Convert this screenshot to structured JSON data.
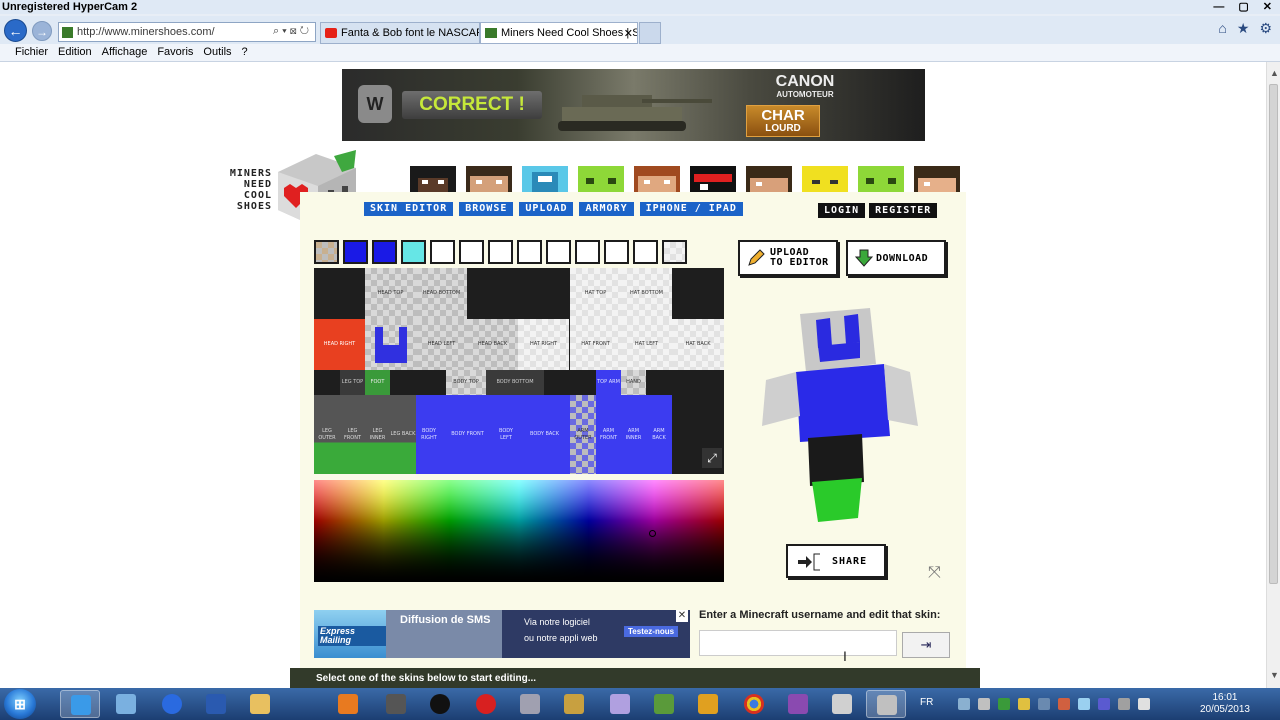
{
  "window": {
    "title": "Unregistered HyperCam 2",
    "controls": [
      "—",
      "▢",
      "✕"
    ]
  },
  "browser": {
    "url": "http://www.minershoes.com/",
    "tabs": [
      {
        "label": "Fanta & Bob font le NASCAR E...",
        "active": false
      },
      {
        "label": "Miners Need Cool Shoes | S...",
        "active": true
      }
    ],
    "tab_close": "✕",
    "menu": [
      "Fichier",
      "Edition",
      "Affichage",
      "Favoris",
      "Outils",
      "?"
    ]
  },
  "banner_ad": {
    "correct": "CORRECT !",
    "canon": "CANON",
    "automoteur": "AUTOMOTEUR",
    "char": "CHAR",
    "lourd": "LOURD"
  },
  "site": {
    "logo_lines": [
      "MINERS",
      "NEED",
      "COOL",
      "SHOES"
    ],
    "nav": [
      "SKIN EDITOR",
      "BROWSE",
      "UPLOAD",
      "ARMORY",
      "IPHONE / IPAD"
    ],
    "auth": [
      "LOGIN",
      "REGISTER"
    ]
  },
  "palette": {
    "colors": [
      "#1a1ae6",
      "#1a1ae6",
      "#66e6e6",
      "#ffffff",
      "#ffffff",
      "#ffffff",
      "#ffffff",
      "#ffffff",
      "#ffffff",
      "#ffffff",
      "#ffffff",
      "#ffffff",
      "#ffffff"
    ]
  },
  "skin_labels": {
    "head_top": "HEAD TOP",
    "head_bottom": "HEAD BOTTOM",
    "hat_top": "HAT TOP",
    "hat_bottom": "HAT BOTTOM",
    "head_right": "HEAD RIGHT",
    "head_front": "HEAD FRONT",
    "head_left": "HEAD LEFT",
    "head_back": "HEAD BACK",
    "hat_right": "HAT RIGHT",
    "hat_front": "HAT FRONT",
    "hat_left": "HAT LEFT",
    "hat_back": "HAT BACK",
    "leg_top": "LEG TOP",
    "foot": "FOOT",
    "body_top": "BODY TOP",
    "body_bottom": "BODY BOTTOM",
    "arm_top": "TOP ARM",
    "hand": "HAND",
    "leg_outer": "LEG OUTER",
    "leg_front": "LEG FRONT",
    "leg_inner": "LEG INNER",
    "leg_back": "LEG BACK",
    "body_right": "BODY RIGHT",
    "body_front": "BODY FRONT",
    "body_left": "BODY LEFT",
    "body_back": "BODY BACK",
    "arm_outer": "ARM OUTER",
    "arm_front": "ARM FRONT",
    "arm_inner": "ARM INNER",
    "arm_back": "ARM BACK"
  },
  "editor": {
    "upload_label_1": "UPLOAD",
    "upload_label_2": "TO EDITOR",
    "download_label": "DOWNLOAD",
    "share_label": "SHARE",
    "username_prompt": "Enter a Minecraft username and edit that skin:",
    "username_value": "",
    "go_icon": "⇥"
  },
  "ad2": {
    "brand": "Express Mailing",
    "title": "Diffusion de SMS",
    "line1": "Via notre logiciel",
    "line2": "ou notre appli web",
    "cta": "Testez-nous",
    "close": "✕"
  },
  "status": "Select one of the skins below to start editing...",
  "taskbar": {
    "lang": "FR",
    "time": "16:01",
    "date": "20/05/2013"
  }
}
